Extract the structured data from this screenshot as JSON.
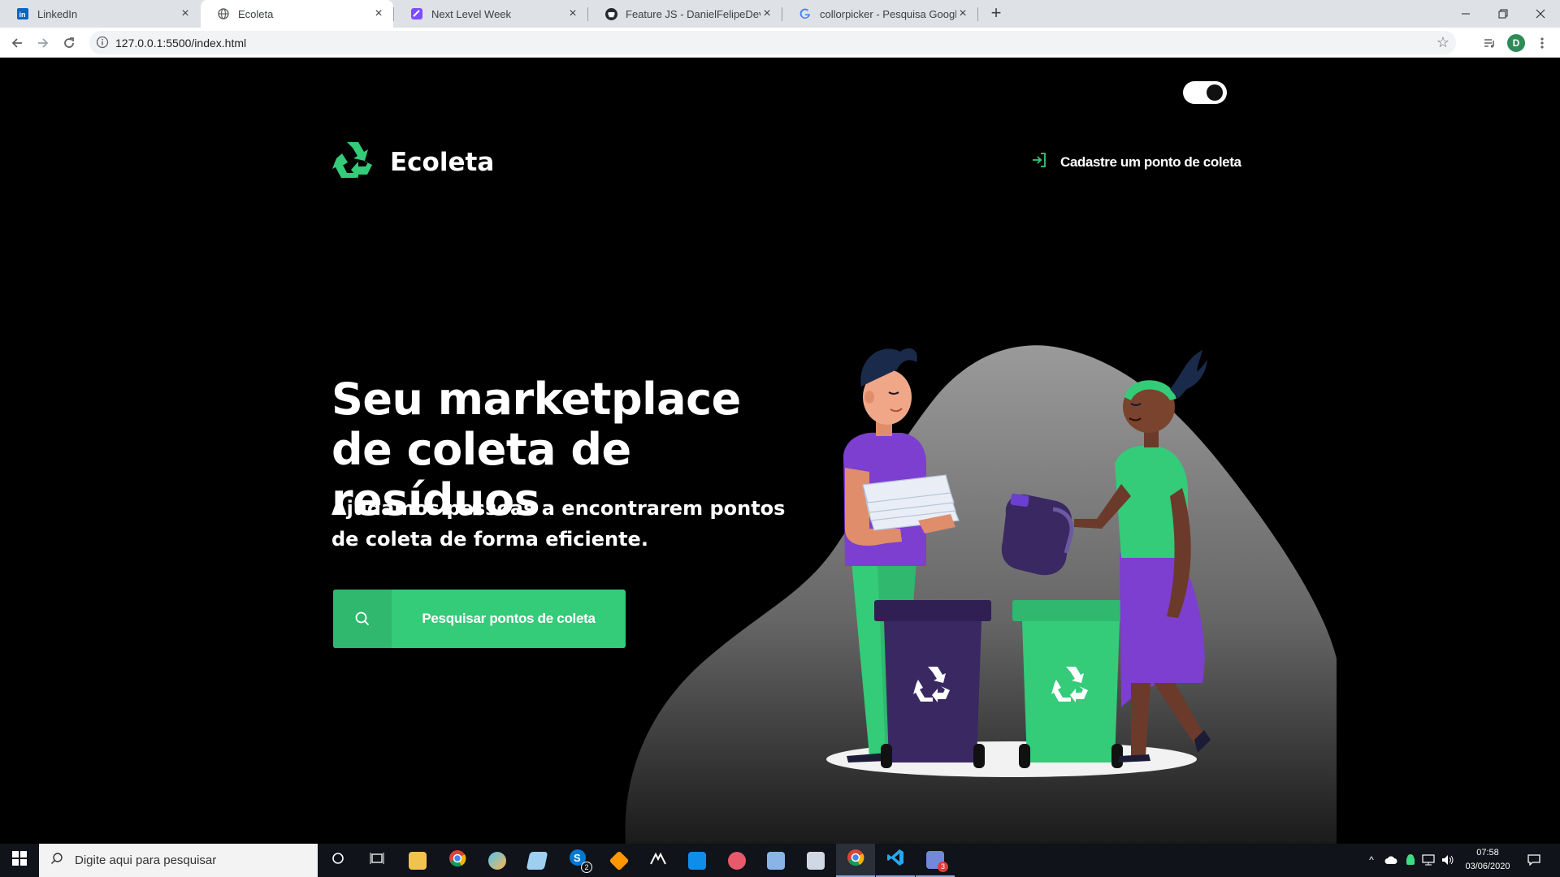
{
  "browser": {
    "tabs": [
      {
        "title": "LinkedIn",
        "icon": "linkedin-icon",
        "active": false
      },
      {
        "title": "Ecoleta",
        "icon": "globe-icon",
        "active": true
      },
      {
        "title": "Next Level Week",
        "icon": "nlw-icon",
        "active": false
      },
      {
        "title": "Feature JS - DanielFelipeDevelope",
        "icon": "github-icon",
        "active": false
      },
      {
        "title": "collorpicker - Pesquisa Google",
        "icon": "google-icon",
        "active": false
      }
    ],
    "new_tab_label": "+",
    "url": "127.0.0.1:5500/index.html",
    "profile_initial": "D"
  },
  "page": {
    "theme_toggle_on": true,
    "brand": "Ecoleta",
    "register_link": "Cadastre um ponto de coleta",
    "headline": "Seu marketplace de coleta de resíduos",
    "subtitle": "Ajudamos pessoas a encontrarem pontos de coleta de forma eficiente.",
    "search_button": "Pesquisar pontos de coleta"
  },
  "taskbar": {
    "search_placeholder": "Digite aqui para pesquisar",
    "time": "07:58",
    "date": "03/06/2020",
    "skype_badge": "2",
    "discord_badge": "3"
  },
  "colors": {
    "accent": "#34cb79",
    "accent_dark": "#2fb86e",
    "purple": "#6c2fb6",
    "background": "#000000"
  }
}
